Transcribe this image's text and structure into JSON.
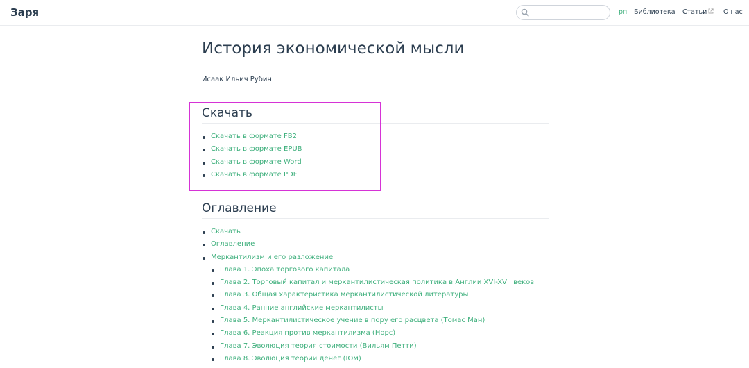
{
  "navbar": {
    "site_name": "Заря",
    "search": {
      "value": "",
      "placeholder": ""
    },
    "links": {
      "rp": "рп",
      "library": "Библиотека",
      "articles": "Статьи",
      "about": "О нас"
    }
  },
  "page": {
    "title": "История экономической мысли",
    "author": "Исаак Ильич Рубин"
  },
  "download": {
    "heading": "Скачать",
    "items": [
      "Скачать в формате FB2",
      "Скачать в формате EPUB",
      "Скачать в формате Word",
      "Скачать в формате PDF"
    ]
  },
  "toc": {
    "heading": "Оглавление",
    "items": [
      {
        "label": "Скачать",
        "level": 1
      },
      {
        "label": "Оглавление",
        "level": 1
      },
      {
        "label": "Меркантилизм и его разложение",
        "level": 1
      },
      {
        "label": "Глава 1. Эпоха торгового капитала",
        "level": 2
      },
      {
        "label": "Глава 2. Торговый капитал и меркантилистическая политика в Англии XVI-XVII веков",
        "level": 2
      },
      {
        "label": "Глава 3. Общая характеристика меркантилистической литературы",
        "level": 2
      },
      {
        "label": "Глава 4. Ранние английские меркантилисты",
        "level": 2
      },
      {
        "label": "Глава 5. Меркантилистическое учение в пору его расцвета (Томас Ман)",
        "level": 2
      },
      {
        "label": "Глава 6. Реакция против меркантилизма (Норс)",
        "level": 2
      },
      {
        "label": "Глава 7. Эволюция теория стоимости (Вильям Петти)",
        "level": 2
      },
      {
        "label": "Глава 8. Эволюция теории денег (Юм)",
        "level": 2
      }
    ]
  },
  "colors": {
    "accent": "#3eaf7c",
    "text": "#2c3e50",
    "highlight": "#d633d6",
    "border": "#eaecef"
  }
}
